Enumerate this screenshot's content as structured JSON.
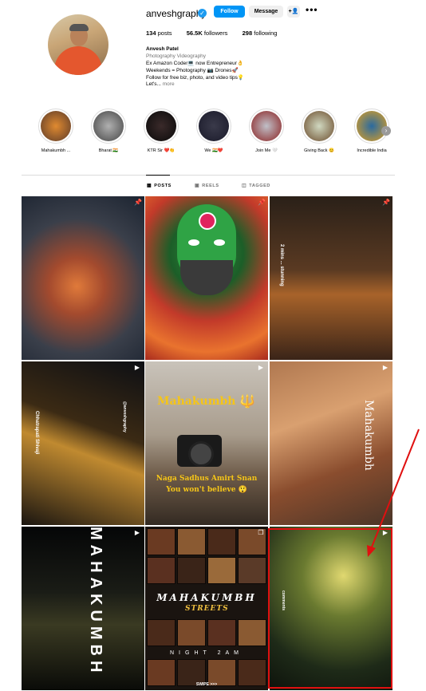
{
  "profile": {
    "username": "anveshgraphy",
    "buttons": {
      "follow": "Follow",
      "message": "Message",
      "add_user": "+👤",
      "more": "•••"
    },
    "stats": {
      "posts_n": "134",
      "posts_l": "posts",
      "followers_n": "56.5K",
      "followers_l": "followers",
      "following_n": "298",
      "following_l": "following"
    },
    "bio": {
      "name": "Anvesh Patel",
      "category": "Photography Videography",
      "line1": "Ex Amazon Coder💻 now Entrepreneur👌",
      "line2": "Weekends = Photography 📷 Drones🚀",
      "line3": "Follow for free biz, photo, and video tips💡",
      "line4_text": "Let's... ",
      "more": "more"
    }
  },
  "highlights": [
    {
      "label": "Mahakumbh ...",
      "color1": "#e08a30",
      "color2": "#5a3a2a"
    },
    {
      "label": "Bharat 🇮🇳",
      "color1": "#b0b0b0",
      "color2": "#444444"
    },
    {
      "label": "KTR Sir ❤️👏",
      "color1": "#3a2a2a",
      "color2": "#0a0a0a"
    },
    {
      "label": "We 🇮🇳❤️",
      "color1": "#3a3a4a",
      "color2": "#1a1a2a"
    },
    {
      "label": "Join Me 🤍",
      "color1": "#c0c0c8",
      "color2": "#8a2020"
    },
    {
      "label": "Giving Back 😊",
      "color1": "#d0d8c0",
      "color2": "#6a4a2a"
    },
    {
      "label": "Incredible India",
      "color1": "#2a6aa0",
      "color2": "#e0a020"
    }
  ],
  "tabs": {
    "posts": "POSTS",
    "reels": "REELS",
    "tagged": "TAGGED"
  },
  "posts": {
    "t1_caption": "(unreadable small text)",
    "t3_side": "2 mins ... stunning",
    "t4_side1": "Chhatrapati Shivaji",
    "t4_side2": "@anveshgraphy",
    "t5_title": "Mahakumbh",
    "t5_caption1": "Naga Sadhus Amirt Snan",
    "t5_caption2": "You won't believe 😲",
    "t6_side": "Mahakumbh",
    "t7_side": "MAHAKUMBH",
    "t8_title": "MAHAKUMBH",
    "t8_sub": "STREETS",
    "t8_night": "NIGHT 2AM",
    "t8_swipe": "SWIPE >>>",
    "t9_side": "comments"
  },
  "icons": {
    "pin": "📌",
    "reel": "▶",
    "trident": "🔱"
  },
  "colors": {
    "accent": "#0095f6",
    "verified": "#1d9bf0",
    "annotation": "#e01010"
  }
}
